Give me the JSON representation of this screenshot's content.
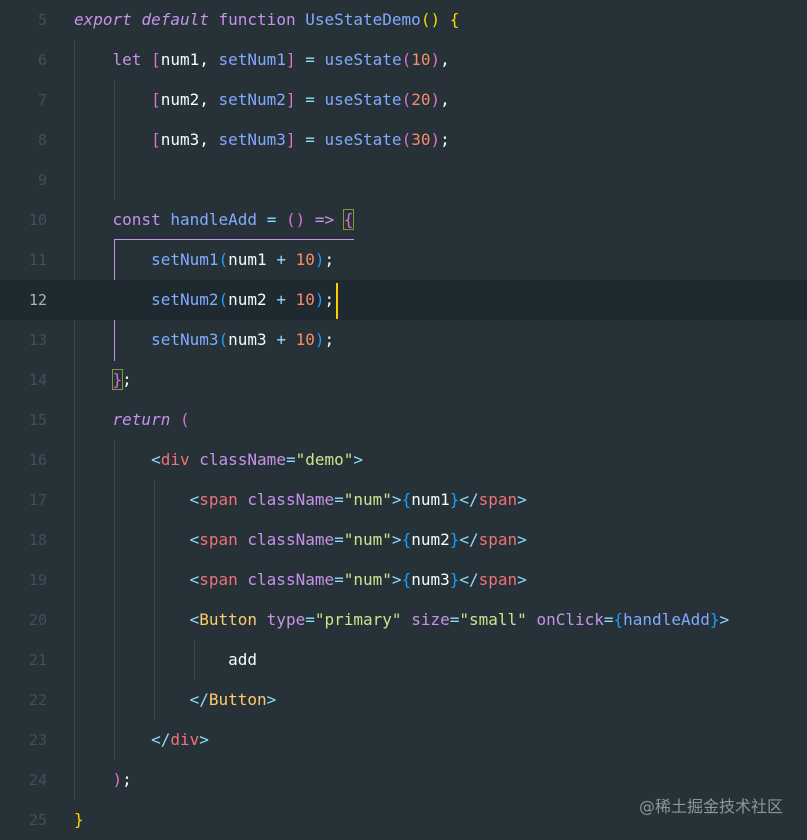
{
  "editor": {
    "lines": [
      {
        "n": "5",
        "tokens": [
          [
            "kw-i",
            "export"
          ],
          [
            "var",
            " "
          ],
          [
            "kw-i",
            "default"
          ],
          [
            "var",
            " "
          ],
          [
            "kw",
            "function"
          ],
          [
            "var",
            " "
          ],
          [
            "fn",
            "UseStateDemo"
          ],
          [
            "br-y",
            "()"
          ],
          [
            "var",
            " "
          ],
          [
            "br-y",
            "{"
          ]
        ]
      },
      {
        "n": "6",
        "tokens": [
          [
            "var",
            "    "
          ],
          [
            "kw",
            "let"
          ],
          [
            "var",
            " "
          ],
          [
            "br-p",
            "["
          ],
          [
            "var",
            "num1, "
          ],
          [
            "fn",
            "setNum1"
          ],
          [
            "br-p",
            "]"
          ],
          [
            "var",
            " "
          ],
          [
            "pun",
            "="
          ],
          [
            "var",
            " "
          ],
          [
            "fn",
            "useState"
          ],
          [
            "br-p",
            "("
          ],
          [
            "num",
            "10"
          ],
          [
            "br-p",
            ")"
          ],
          [
            "var",
            ","
          ]
        ]
      },
      {
        "n": "7",
        "tokens": [
          [
            "var",
            "        "
          ],
          [
            "br-p",
            "["
          ],
          [
            "var",
            "num2, "
          ],
          [
            "fn",
            "setNum2"
          ],
          [
            "br-p",
            "]"
          ],
          [
            "var",
            " "
          ],
          [
            "pun",
            "="
          ],
          [
            "var",
            " "
          ],
          [
            "fn",
            "useState"
          ],
          [
            "br-p",
            "("
          ],
          [
            "num",
            "20"
          ],
          [
            "br-p",
            ")"
          ],
          [
            "var",
            ","
          ]
        ]
      },
      {
        "n": "8",
        "tokens": [
          [
            "var",
            "        "
          ],
          [
            "br-p",
            "["
          ],
          [
            "var",
            "num3, "
          ],
          [
            "fn",
            "setNum3"
          ],
          [
            "br-p",
            "]"
          ],
          [
            "var",
            " "
          ],
          [
            "pun",
            "="
          ],
          [
            "var",
            " "
          ],
          [
            "fn",
            "useState"
          ],
          [
            "br-p",
            "("
          ],
          [
            "num",
            "30"
          ],
          [
            "br-p",
            ")"
          ],
          [
            "var",
            ";"
          ]
        ]
      },
      {
        "n": "9",
        "tokens": []
      },
      {
        "n": "10",
        "tokens": [
          [
            "var",
            "    "
          ],
          [
            "kw",
            "const"
          ],
          [
            "var",
            " "
          ],
          [
            "fn",
            "handleAdd"
          ],
          [
            "var",
            " "
          ],
          [
            "pun",
            "="
          ],
          [
            "var",
            " "
          ],
          [
            "br-p",
            "()"
          ],
          [
            "var",
            " "
          ],
          [
            "kw",
            "=>"
          ],
          [
            "var",
            " "
          ],
          [
            "br-p",
            "{"
          ]
        ]
      },
      {
        "n": "11",
        "tokens": [
          [
            "var",
            "        "
          ],
          [
            "fn",
            "setNum1"
          ],
          [
            "br-b",
            "("
          ],
          [
            "var",
            "num1 "
          ],
          [
            "pun",
            "+"
          ],
          [
            "var",
            " "
          ],
          [
            "num",
            "10"
          ],
          [
            "br-b",
            ")"
          ],
          [
            "var",
            ";"
          ]
        ]
      },
      {
        "n": "12",
        "tokens": [
          [
            "var",
            "        "
          ],
          [
            "fn",
            "setNum2"
          ],
          [
            "br-b",
            "("
          ],
          [
            "var",
            "num2 "
          ],
          [
            "pun",
            "+"
          ],
          [
            "var",
            " "
          ],
          [
            "num",
            "10"
          ],
          [
            "br-b",
            ")"
          ],
          [
            "var",
            ";"
          ]
        ]
      },
      {
        "n": "13",
        "tokens": [
          [
            "var",
            "        "
          ],
          [
            "fn",
            "setNum3"
          ],
          [
            "br-b",
            "("
          ],
          [
            "var",
            "num3 "
          ],
          [
            "pun",
            "+"
          ],
          [
            "var",
            " "
          ],
          [
            "num",
            "10"
          ],
          [
            "br-b",
            ")"
          ],
          [
            "var",
            ";"
          ]
        ]
      },
      {
        "n": "14",
        "tokens": [
          [
            "var",
            "    "
          ],
          [
            "br-p",
            "}"
          ],
          [
            "var",
            ";"
          ]
        ]
      },
      {
        "n": "15",
        "tokens": [
          [
            "var",
            "    "
          ],
          [
            "kw-i",
            "return"
          ],
          [
            "var",
            " "
          ],
          [
            "br-p",
            "("
          ]
        ]
      },
      {
        "n": "16",
        "tokens": [
          [
            "var",
            "        "
          ],
          [
            "pun",
            "<"
          ],
          [
            "tag",
            "div"
          ],
          [
            "var",
            " "
          ],
          [
            "attr",
            "className"
          ],
          [
            "pun",
            "="
          ],
          [
            "str",
            "\"demo\""
          ],
          [
            "pun",
            ">"
          ]
        ]
      },
      {
        "n": "17",
        "tokens": [
          [
            "var",
            "            "
          ],
          [
            "pun",
            "<"
          ],
          [
            "tag",
            "span"
          ],
          [
            "var",
            " "
          ],
          [
            "attr",
            "className"
          ],
          [
            "pun",
            "="
          ],
          [
            "str",
            "\"num\""
          ],
          [
            "pun",
            ">"
          ],
          [
            "br-b",
            "{"
          ],
          [
            "var",
            "num1"
          ],
          [
            "br-b",
            "}"
          ],
          [
            "pun",
            "</"
          ],
          [
            "tag",
            "span"
          ],
          [
            "pun",
            ">"
          ]
        ]
      },
      {
        "n": "18",
        "tokens": [
          [
            "var",
            "            "
          ],
          [
            "pun",
            "<"
          ],
          [
            "tag",
            "span"
          ],
          [
            "var",
            " "
          ],
          [
            "attr",
            "className"
          ],
          [
            "pun",
            "="
          ],
          [
            "str",
            "\"num\""
          ],
          [
            "pun",
            ">"
          ],
          [
            "br-b",
            "{"
          ],
          [
            "var",
            "num2"
          ],
          [
            "br-b",
            "}"
          ],
          [
            "pun",
            "</"
          ],
          [
            "tag",
            "span"
          ],
          [
            "pun",
            ">"
          ]
        ]
      },
      {
        "n": "19",
        "tokens": [
          [
            "var",
            "            "
          ],
          [
            "pun",
            "<"
          ],
          [
            "tag",
            "span"
          ],
          [
            "var",
            " "
          ],
          [
            "attr",
            "className"
          ],
          [
            "pun",
            "="
          ],
          [
            "str",
            "\"num\""
          ],
          [
            "pun",
            ">"
          ],
          [
            "br-b",
            "{"
          ],
          [
            "var",
            "num3"
          ],
          [
            "br-b",
            "}"
          ],
          [
            "pun",
            "</"
          ],
          [
            "tag",
            "span"
          ],
          [
            "pun",
            ">"
          ]
        ]
      },
      {
        "n": "20",
        "tokens": [
          [
            "var",
            "            "
          ],
          [
            "pun",
            "<"
          ],
          [
            "cmp",
            "Button"
          ],
          [
            "var",
            " "
          ],
          [
            "attr",
            "type"
          ],
          [
            "pun",
            "="
          ],
          [
            "str",
            "\"primary\""
          ],
          [
            "var",
            " "
          ],
          [
            "attr",
            "size"
          ],
          [
            "pun",
            "="
          ],
          [
            "str",
            "\"small\""
          ],
          [
            "var",
            " "
          ],
          [
            "attr",
            "onClick"
          ],
          [
            "pun",
            "="
          ],
          [
            "br-b",
            "{"
          ],
          [
            "fn",
            "handleAdd"
          ],
          [
            "br-b",
            "}"
          ],
          [
            "pun",
            ">"
          ]
        ]
      },
      {
        "n": "21",
        "tokens": [
          [
            "var",
            "                add"
          ]
        ]
      },
      {
        "n": "22",
        "tokens": [
          [
            "var",
            "            "
          ],
          [
            "pun",
            "</"
          ],
          [
            "cmp",
            "Button"
          ],
          [
            "pun",
            ">"
          ]
        ]
      },
      {
        "n": "23",
        "tokens": [
          [
            "var",
            "        "
          ],
          [
            "pun",
            "</"
          ],
          [
            "tag",
            "div"
          ],
          [
            "pun",
            ">"
          ]
        ]
      },
      {
        "n": "24",
        "tokens": [
          [
            "var",
            "    "
          ],
          [
            "br-p",
            ")"
          ],
          [
            "var",
            ";"
          ]
        ]
      },
      {
        "n": "25",
        "tokens": [
          [
            "br-y",
            "}"
          ]
        ]
      }
    ],
    "current_line": "12"
  },
  "watermark": "@稀土掘金技术社区"
}
